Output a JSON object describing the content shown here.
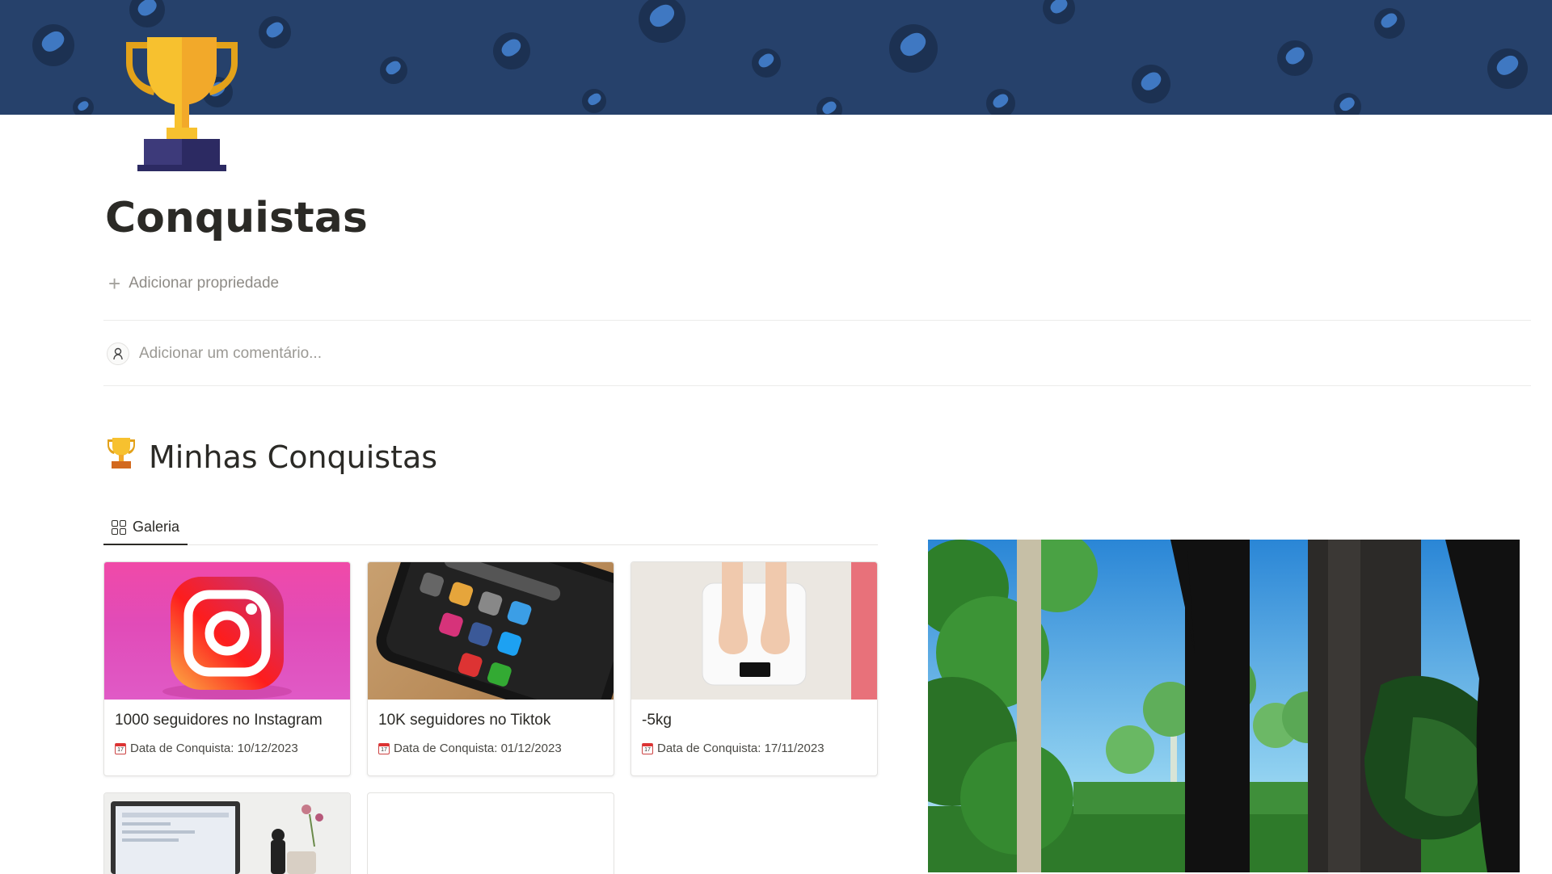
{
  "page": {
    "title": "Conquistas",
    "icon": "trophy-icon",
    "add_property_label": "Adicionar propriedade",
    "comment_placeholder": "Adicionar um comentário..."
  },
  "section": {
    "icon": "trophy-icon",
    "heading": "Minhas Conquistas"
  },
  "view_tab": {
    "icon": "gallery-grid-icon",
    "label": "Galeria"
  },
  "cards": [
    {
      "name": "1000 seguidores no Instagram",
      "date_prop": "Data de Conquista: 10/12/2023",
      "image": "instagram-logo"
    },
    {
      "name": "10K seguidores no Tiktok",
      "date_prop": "Data de Conquista: 01/12/2023",
      "image": "phone-social-media"
    },
    {
      "name": "-5kg",
      "date_prop": "Data de Conquista: 17/11/2023",
      "image": "feet-on-scale"
    }
  ],
  "partial_cards": [
    {
      "image": "laptop-desk"
    },
    {
      "image": "blank"
    }
  ],
  "embed": {
    "image": "pixel-art-forest"
  },
  "colors": {
    "cover_bg": "#26416b",
    "instagram_gradient_top": "#f53fa8",
    "trophy_gold": "#f7c12f"
  }
}
